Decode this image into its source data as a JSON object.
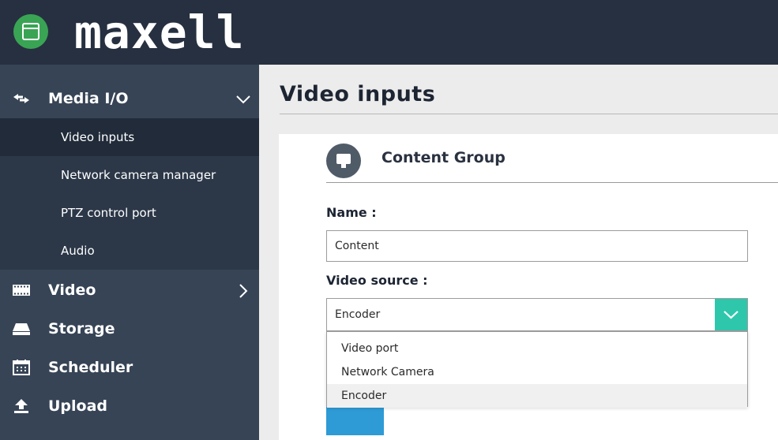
{
  "header": {
    "brand": "maxell"
  },
  "sidebar": {
    "sections": [
      {
        "label": "Media I/O",
        "icon": "arrows-swap-icon",
        "state": "expanded"
      },
      {
        "label": "Video",
        "icon": "film-strip-icon",
        "state": "collapsed"
      },
      {
        "label": "Storage",
        "icon": "drive-icon"
      },
      {
        "label": "Scheduler",
        "icon": "calendar-icon"
      },
      {
        "label": "Upload",
        "icon": "upload-icon"
      }
    ],
    "media_items": [
      {
        "label": "Video inputs",
        "active": true
      },
      {
        "label": "Network camera manager"
      },
      {
        "label": "PTZ control port"
      },
      {
        "label": "Audio"
      }
    ]
  },
  "main": {
    "page_title": "Video inputs",
    "group": {
      "icon": "monitor-icon",
      "title": "Content Group"
    },
    "name_label": "Name :",
    "name_value": "Content",
    "source_label": "Video source :",
    "source_value": "Encoder",
    "source_options": [
      "Video port",
      "Network Camera",
      "Encoder"
    ],
    "selected_option": "Encoder"
  },
  "colors": {
    "header_bg": "#263040",
    "sidebar_bg": "#374456",
    "submenu_bg": "#2c3848",
    "submenu_active_bg": "#212b39",
    "accent_teal": "#2ec7ac",
    "button_blue": "#2e9bd6",
    "app_icon_green": "#3aa455"
  }
}
